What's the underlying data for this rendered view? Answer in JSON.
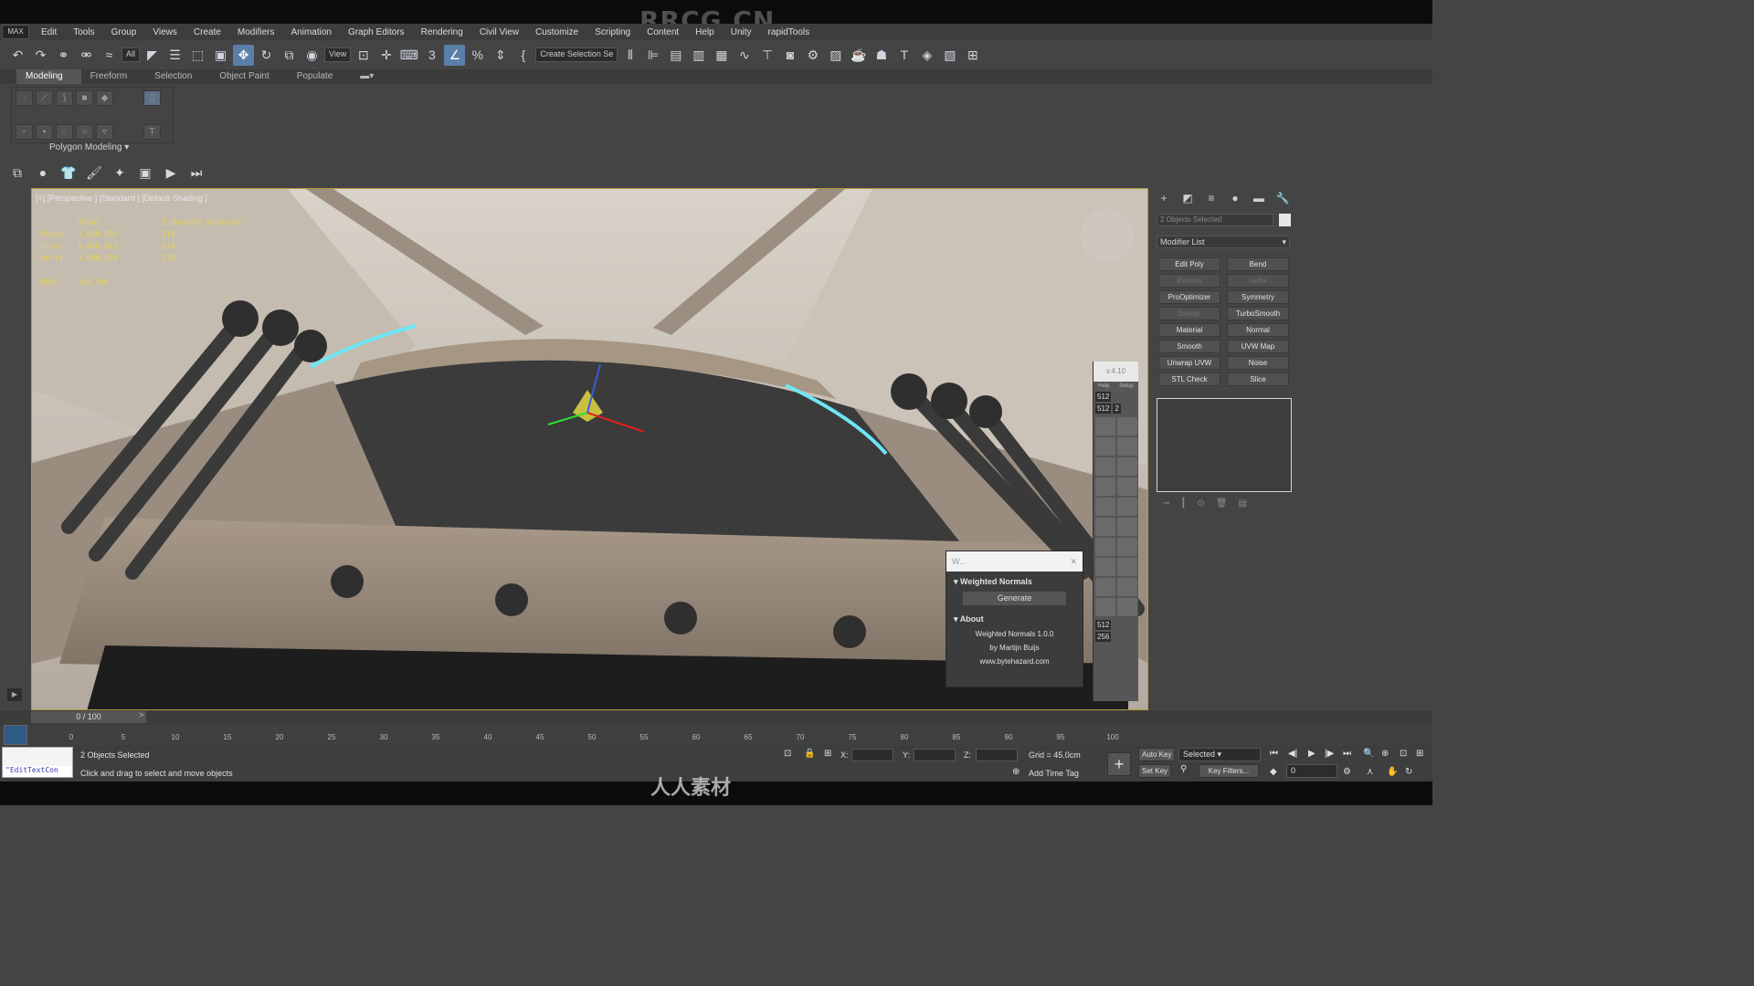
{
  "watermark": "RRCG.CN",
  "bottom_watermark": "人人素材",
  "menu": [
    "Edit",
    "Tools",
    "Group",
    "Views",
    "Create",
    "Modifiers",
    "Animation",
    "Graph Editors",
    "Rendering",
    "Civil View",
    "Customize",
    "Scripting",
    "Content",
    "Help",
    "Unity",
    "rapidTools"
  ],
  "app_logo": "MAX",
  "toolbar": {
    "selection_filter": "All",
    "ref_coord": "View",
    "selection_set": "Create Selection Se"
  },
  "ribbon": {
    "tabs": [
      "Modeling",
      "Freeform",
      "Selection",
      "Object Paint",
      "Populate"
    ],
    "panel_label": "Polygon Modeling"
  },
  "viewport": {
    "label": "[+] [Perspective ] [Standard ] [Default Shading ]",
    "stats": {
      "header": [
        "Total",
        "2 Objects Selected"
      ],
      "rows": [
        [
          "Polys:",
          "1,019,995",
          "112"
        ],
        [
          "Tris:",
          "1,926,122",
          "224"
        ],
        [
          "Verts:",
          "1,008,298",
          "128"
        ]
      ],
      "fps_label": "FPS:",
      "fps_value": "154.786"
    }
  },
  "weighted_normals": {
    "title": "W...",
    "section1": "Weighted Normals",
    "generate": "Generate",
    "section2": "About",
    "about_lines": [
      "Weighted Normals 1.0.0",
      "by Martijn Buijs",
      "www.bytehazard.com"
    ]
  },
  "tool_column": {
    "version": "v.4.10",
    "help": "Help",
    "setup": "Setup",
    "res1": "512",
    "res2": "512",
    "res2b": "2",
    "res3": "512",
    "res4": "256"
  },
  "command_panel": {
    "object_name": "2 Objects Selected",
    "modifier_list": "Modifier List",
    "modifiers": [
      {
        "label": "Edit Poly",
        "enabled": true
      },
      {
        "label": "Bend",
        "enabled": true
      },
      {
        "label": "Extrude",
        "enabled": false
      },
      {
        "label": "Lathe",
        "enabled": false
      },
      {
        "label": "ProOptimizer",
        "enabled": true
      },
      {
        "label": "Symmetry",
        "enabled": true
      },
      {
        "label": "Sweep",
        "enabled": false
      },
      {
        "label": "TurboSmooth",
        "enabled": true
      },
      {
        "label": "Material",
        "enabled": true
      },
      {
        "label": "Normal",
        "enabled": true
      },
      {
        "label": "Smooth",
        "enabled": true
      },
      {
        "label": "UVW Map",
        "enabled": true
      },
      {
        "label": "Unwrap UVW",
        "enabled": true
      },
      {
        "label": "Noise",
        "enabled": true
      },
      {
        "label": "STL Check",
        "enabled": true
      },
      {
        "label": "Slice",
        "enabled": true
      }
    ]
  },
  "timeline": {
    "frame": "0 / 100",
    "ticks": [
      "0",
      "5",
      "10",
      "15",
      "20",
      "25",
      "30",
      "35",
      "40",
      "45",
      "50",
      "55",
      "60",
      "65",
      "70",
      "75",
      "80",
      "85",
      "90",
      "95",
      "100"
    ]
  },
  "status": {
    "maxscript": "\"EditTextCon",
    "selection": "2 Objects Selected",
    "prompt": "Click and drag to select and move objects",
    "x_label": "X:",
    "y_label": "Y:",
    "z_label": "Z:",
    "grid": "Grid = 45.0cm",
    "add_time_tag": "Add Time Tag",
    "auto_key": "Auto Key",
    "set_key": "Set Key",
    "selected": "Selected",
    "key_filters": "Key Filters...",
    "frame_field": "0"
  }
}
